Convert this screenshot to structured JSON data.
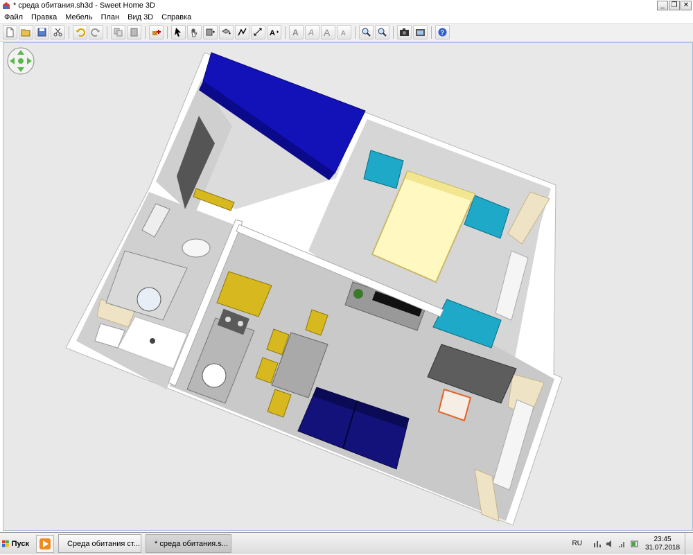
{
  "window": {
    "title": "* среда обитания.sh3d - Sweet Home 3D",
    "minimize_label": "_",
    "restore_label": "❐",
    "close_label": "✕"
  },
  "menu": [
    "Файл",
    "Правка",
    "Мебель",
    "План",
    "Вид 3D",
    "Справка"
  ],
  "toolbar": {
    "buttons": [
      "new-home",
      "open",
      "save",
      "cut",
      "undo",
      "redo",
      "copy",
      "paste",
      "add-furniture",
      "select-mode",
      "pan-mode",
      "create-walls",
      "create-rooms",
      "create-polylines",
      "create-dimensions",
      "add-text",
      "text-style-bold",
      "text-style-italic",
      "increase-text-size",
      "decrease-text-size",
      "zoom-in",
      "zoom-out",
      "create-photo",
      "create-video",
      "help"
    ]
  },
  "colors": {
    "accent_navy": "#1a1aa8",
    "wardrobe_blue": "#1f1fc4",
    "teal": "#1ea9c8",
    "bed": "#fff8c0",
    "yellow": "#d7b81e",
    "wall_white": "#ffffff",
    "floor_gray": "#c4c4c4"
  },
  "taskbar": {
    "start_label": "Пуск",
    "tasks": [
      {
        "label": "Среда обитания ст...",
        "icon": "yandex-browser-icon"
      },
      {
        "label": "* среда обитания.s...",
        "icon": "sweet-home-3d-icon"
      }
    ],
    "language": "RU",
    "time": "23:45",
    "date": "31.07.2018"
  }
}
